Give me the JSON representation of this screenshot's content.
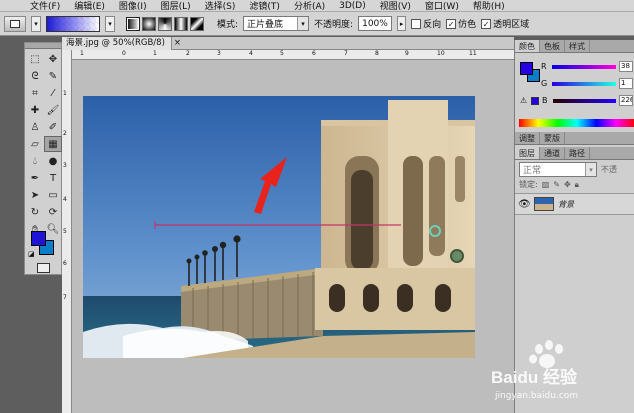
{
  "menu": [
    "文件(F)",
    "编辑(E)",
    "图像(I)",
    "图层(L)",
    "选择(S)",
    "滤镜(T)",
    "分析(A)",
    "3D(D)",
    "视图(V)",
    "窗口(W)",
    "帮助(H)"
  ],
  "options": {
    "mode_label": "模式:",
    "mode_value": "正片叠底",
    "opacity_label": "不透明度:",
    "opacity_value": "100%",
    "reverse": "反向",
    "dither": "仿色",
    "transparency": "透明区域",
    "dither_checked": true,
    "transparency_checked": true,
    "reverse_checked": false,
    "gradient_from": "#1e1ad6",
    "gradient_to": "#ffffff"
  },
  "document": {
    "tab_title": "海景.jpg @ 50%(RGB/8)",
    "ruler_h": [
      "1",
      "0",
      "1",
      "2",
      "3",
      "4",
      "5",
      "6",
      "7",
      "8",
      "9",
      "10",
      "11",
      "12"
    ],
    "ruler_v": [
      "1",
      "2",
      "3",
      "4",
      "5",
      "6",
      "7"
    ]
  },
  "toolbox": {
    "foreground": "#1e14d6",
    "background": "#0a7fc8",
    "tools": [
      "move-icon",
      "marquee-icon",
      "lasso-icon",
      "quick-select-icon",
      "crop-icon",
      "eyedropper-icon",
      "healing-icon",
      "brush-icon",
      "stamp-icon",
      "history-brush-icon",
      "eraser-icon",
      "gradient-icon",
      "blur-icon",
      "dodge-icon",
      "pen-icon",
      "type-icon",
      "path-select-icon",
      "shape-icon",
      "rotate-3d-icon",
      "orbit-3d-icon",
      "hand-icon",
      "zoom-icon"
    ]
  },
  "color_panel": {
    "tabs": [
      "颜色",
      "色板",
      "样式"
    ],
    "r": "38",
    "g": "1",
    "b": "226",
    "r_label": "R",
    "g_label": "G",
    "b_label": "B"
  },
  "adjust_tabs": [
    "调整",
    "蒙版"
  ],
  "layers_panel": {
    "tabs": [
      "图层",
      "通道",
      "路径"
    ],
    "blend_mode": "正常",
    "opacity_label": "不透",
    "lock_label": "锁定:",
    "layer_name": "背景"
  },
  "watermark": {
    "brand": "Baidu 经验",
    "url": "jingyan.baidu.com"
  }
}
